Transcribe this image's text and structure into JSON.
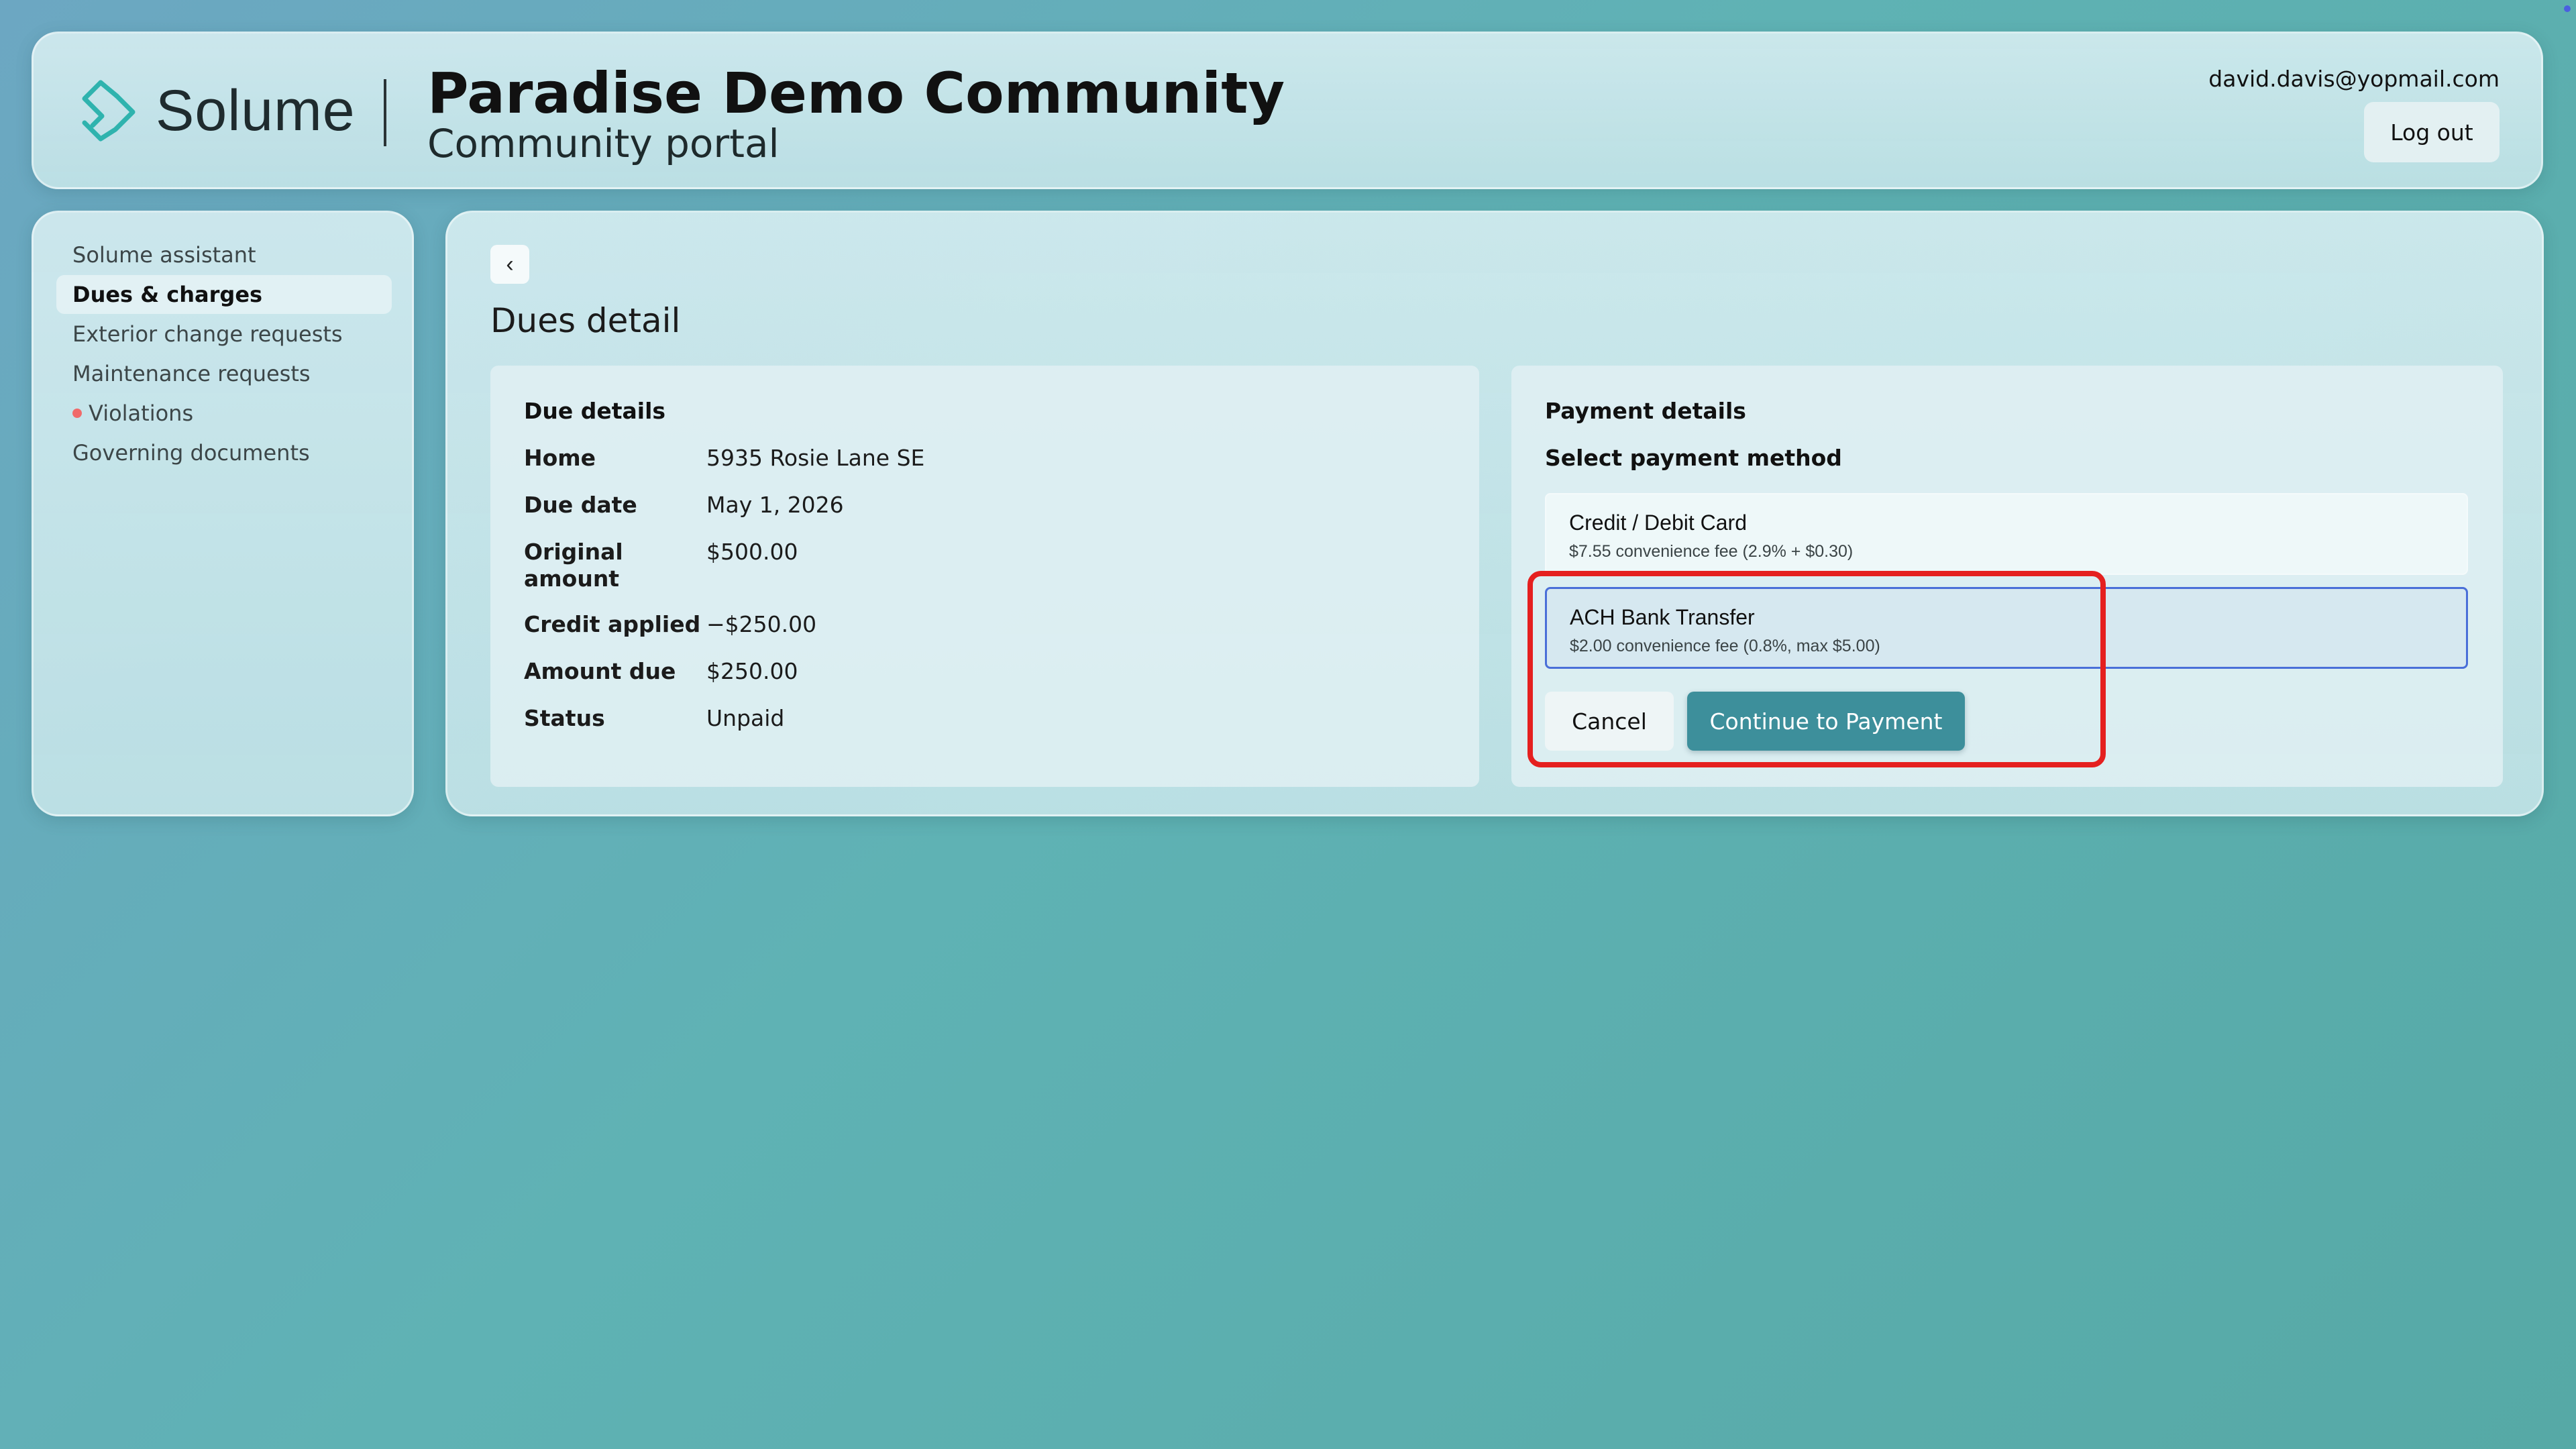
{
  "header": {
    "brand": "Solume",
    "title": "Paradise Demo Community",
    "subtitle": "Community portal",
    "email": "david.davis@yopmail.com",
    "logout_label": "Log out"
  },
  "sidebar": {
    "items": [
      {
        "label": "Solume assistant"
      },
      {
        "label": "Dues & charges"
      },
      {
        "label": "Exterior change requests"
      },
      {
        "label": "Maintenance requests"
      },
      {
        "label": "Violations"
      },
      {
        "label": "Governing documents"
      }
    ]
  },
  "main": {
    "back_icon": "chevron-left-icon",
    "page_title": "Dues detail",
    "due_details": {
      "heading": "Due details",
      "rows": [
        {
          "key": "Home",
          "value": "5935 Rosie Lane SE"
        },
        {
          "key": "Due date",
          "value": "May 1, 2026"
        },
        {
          "key": "Original amount",
          "value": "$500.00"
        },
        {
          "key": "Credit applied",
          "value": "−$250.00"
        },
        {
          "key": "Amount due",
          "value": "$250.00"
        },
        {
          "key": "Status",
          "value": "Unpaid"
        }
      ]
    },
    "payment_details": {
      "heading": "Payment details",
      "select_label": "Select payment method",
      "options": [
        {
          "title": "Credit / Debit Card",
          "fee": "$7.55 convenience fee (2.9% + $0.30)",
          "selected": false
        },
        {
          "title": "ACH Bank Transfer",
          "fee": "$2.00 convenience fee (0.8%, max $5.00)",
          "selected": true
        }
      ],
      "cancel_label": "Cancel",
      "continue_label": "Continue to Payment"
    }
  },
  "colors": {
    "accent": "#3d8f9b",
    "selected_border": "#4a6fd8",
    "highlight": "#e5201f",
    "violation_dot": "#f06a6a"
  }
}
